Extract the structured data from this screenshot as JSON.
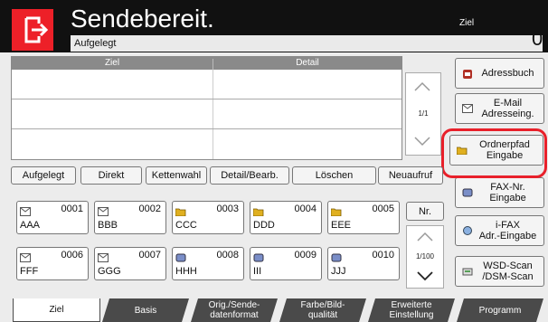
{
  "header": {
    "title": "Sendebereit.",
    "subtitle": "Aufgelegt",
    "ziel_label": "Ziel",
    "ziel_count": "0",
    "home_icon": "send-home-icon"
  },
  "list": {
    "columns": [
      "Ziel",
      "Detail"
    ],
    "page": "1/1"
  },
  "side": [
    {
      "label": "Adressbuch",
      "icon": "addressbook-icon"
    },
    {
      "label": "E-Mail\nAdresseing.",
      "icon": "email-icon"
    },
    {
      "label": "Ordnerpfad\nEingabe",
      "icon": "folder-icon"
    },
    {
      "label": "FAX-Nr.\nEingabe",
      "icon": "fax-icon"
    },
    {
      "label": "i-FAX\nAdr.-Eingabe",
      "icon": "ifax-icon"
    },
    {
      "label": "WSD-Scan\n/DSM-Scan",
      "icon": "wsd-scan-icon"
    }
  ],
  "actions": [
    "Aufgelegt",
    "Direkt",
    "Kettenwahl",
    "Detail/Bearb.",
    "Löschen",
    "Neuaufruf"
  ],
  "keys": [
    {
      "num": "0001",
      "name": "AAA",
      "icon": "email"
    },
    {
      "num": "0002",
      "name": "BBB",
      "icon": "email"
    },
    {
      "num": "0003",
      "name": "CCC",
      "icon": "folder"
    },
    {
      "num": "0004",
      "name": "DDD",
      "icon": "folder"
    },
    {
      "num": "0005",
      "name": "EEE",
      "icon": "folder"
    },
    {
      "num": "0006",
      "name": "FFF",
      "icon": "email"
    },
    {
      "num": "0007",
      "name": "GGG",
      "icon": "email"
    },
    {
      "num": "0008",
      "name": "HHH",
      "icon": "fax"
    },
    {
      "num": "0009",
      "name": "III",
      "icon": "fax"
    },
    {
      "num": "0010",
      "name": "JJJ",
      "icon": "fax"
    }
  ],
  "keypager": {
    "nr": "Nr.",
    "page": "1/100"
  },
  "tabs": [
    {
      "label": "Ziel"
    },
    {
      "label": "Basis"
    },
    {
      "label": "Orig./Sende-\ndatenformat"
    },
    {
      "label": "Farbe/Bild-\nqualität"
    },
    {
      "label": "Erweiterte\nEinstellung"
    },
    {
      "label": "Programm"
    }
  ],
  "colors": {
    "accent": "#ed2028",
    "header": "#111111",
    "tab": "#4a4a4a",
    "highlight": "#e8202a"
  }
}
